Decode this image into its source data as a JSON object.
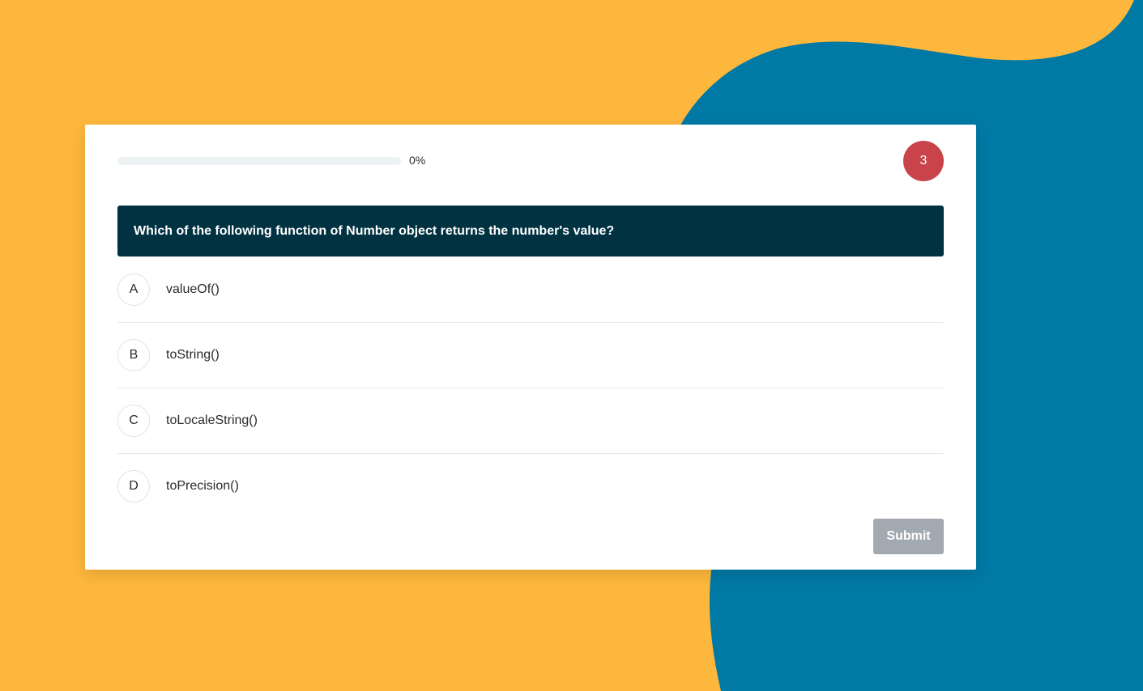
{
  "colors": {
    "background": "#fdb73c",
    "blob": "#0079a5",
    "question_bar": "#003242",
    "timer_badge": "#c9444a",
    "submit_disabled": "#a2a9b0"
  },
  "progress": {
    "value": 0,
    "label": "0%"
  },
  "timer": {
    "value": "3"
  },
  "question": {
    "text": "Which of the following function of Number object returns the number's value?"
  },
  "options": [
    {
      "letter": "A",
      "text": "valueOf()"
    },
    {
      "letter": "B",
      "text": "toString()"
    },
    {
      "letter": "C",
      "text": "toLocaleString()"
    },
    {
      "letter": "D",
      "text": "toPrecision()"
    }
  ],
  "submit": {
    "label": "Submit",
    "disabled": true
  }
}
